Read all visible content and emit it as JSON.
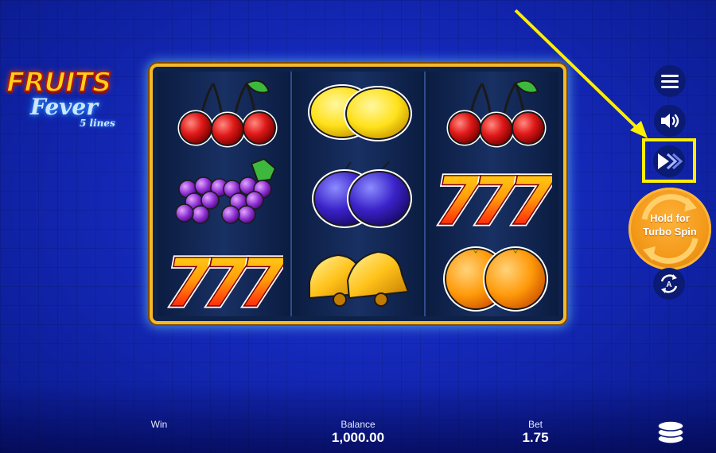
{
  "logo": {
    "word1": "FRUITS",
    "word2": "Fever",
    "word3": "5 lines"
  },
  "reels": [
    [
      "cherries-icon",
      "grapes-icon",
      "sevens-icon"
    ],
    [
      "lemons-icon",
      "plums-icon",
      "bells-icon"
    ],
    [
      "cherries-icon",
      "sevens-icon",
      "oranges-icon"
    ]
  ],
  "controls": {
    "turbo_line1": "Hold for",
    "turbo_line2": "Turbo Spin"
  },
  "stats": {
    "win_label": "Win",
    "win_value": "",
    "balance_label": "Balance",
    "balance_value": "1,000.00",
    "bet_label": "Bet",
    "bet_value": "1.75"
  },
  "colors": {
    "frame": "#f4b82a",
    "highlight": "#ffee00",
    "turbo": "#f39a1a",
    "background": "#1428b8"
  }
}
